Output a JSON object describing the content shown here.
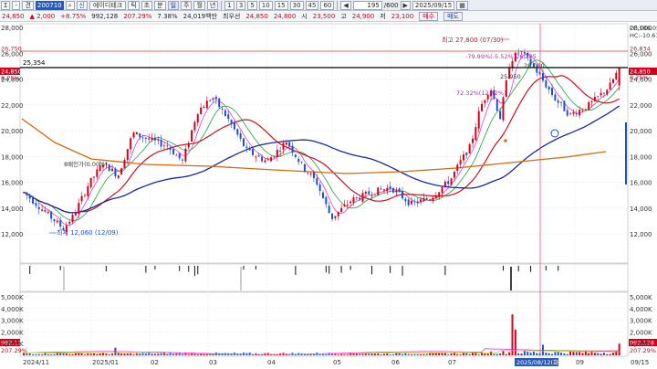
{
  "toolbar": {
    "items": [
      "Σ",
      "-",
      "견"
    ],
    "code": "200710",
    "search_icon": "search-icon",
    "name": "에이디테크",
    "period_tabs": [
      "틱",
      "초",
      "분",
      "일",
      "주",
      "월",
      "년"
    ],
    "period_active": "일",
    "units": [
      "1",
      "3",
      "5",
      "10",
      "15",
      "30",
      "45",
      "60"
    ],
    "count": "195",
    "count_total": "/600",
    "date": "2025/09/15"
  },
  "infobar": {
    "price": "24,850",
    "change": "2,000",
    "change_pct": "+8.75%",
    "volume": "992,128",
    "volume_ratio": "207.29%",
    "turnover_pct": "7.38%",
    "amount": "24,019백만",
    "tier": "최우선",
    "ask": "24,850",
    "bid": "24,800",
    "open_label": "시",
    "open": "23,500",
    "high_label": "고",
    "high": "24,900",
    "low_label": "저",
    "low": "23,100",
    "buy_label": "매수",
    "sell_label": "매도"
  },
  "price_axis": {
    "ticks": [
      "28,000",
      "26,000",
      "24,000",
      "22,000",
      "20,000",
      "18,000",
      "16,000",
      "14,000",
      "12,000"
    ],
    "right_labels": [
      "LC:106.05",
      "HC:-10.61",
      "26,834",
      "24,850",
      "8.75%"
    ],
    "left_labels": [
      "26,750",
      "24,850",
      "8.75%"
    ],
    "hline_label": "25,354"
  },
  "annotations": {
    "high": "최고 27,800 (07/30)",
    "low": "최저 12,060 (12/09)",
    "pct1": "-79.99%(-5.52%)26,285",
    "pct2": "72.32%(12.42%)",
    "pct3": "28,000",
    "pct4": "25,950",
    "left_mid": "8배인가(0.00%)",
    "marker_date": "2025/08/12(화)"
  },
  "volume_axis": {
    "ticks": [
      "5,000K",
      "4,000K",
      "3,000K",
      "2,000K",
      "1,000K"
    ],
    "left_label": "992,128",
    "left_pct": "207.29%",
    "right_label": "992,128",
    "right_pct": "207.29%"
  },
  "date_axis": [
    "2024/11",
    "2025/01",
    "02",
    "03",
    "04",
    "05",
    "06",
    "07",
    "2025/08/12(화)",
    "09",
    "09/15"
  ],
  "colors": {
    "up": "#d4001a",
    "down": "#1d4fd6",
    "ma5": "#e020d0",
    "ma20": "#cc1020",
    "ma60": "#1a2a9c",
    "ma120": "#d46a10",
    "ma10": "#20a040"
  }
}
